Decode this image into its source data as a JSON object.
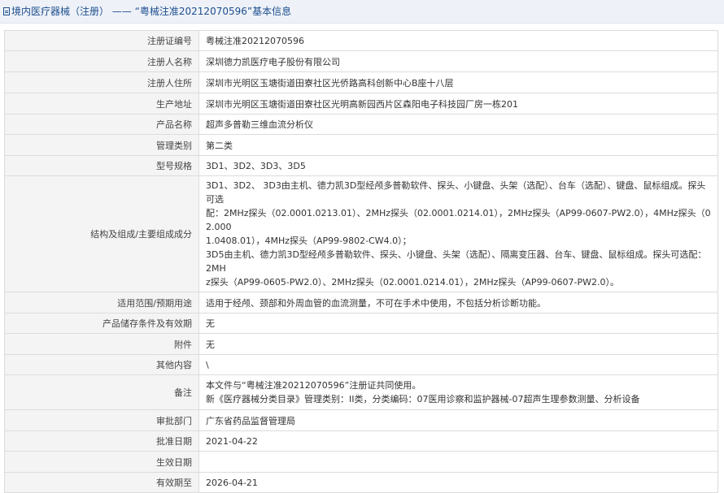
{
  "header": {
    "category": "境内医疗器械（注册）",
    "separator": "——",
    "title": "“粤械注准20212070596”基本信息"
  },
  "rows": [
    {
      "label": "注册证编号",
      "value": "粤械注准20212070596"
    },
    {
      "label": "注册人名称",
      "value": "深圳德力凯医疗电子股份有限公司"
    },
    {
      "label": "注册人住所",
      "value": "深圳市光明区玉塘街道田寮社区光侨路高科创新中心B座十八层"
    },
    {
      "label": "生产地址",
      "value": "深圳市光明区玉塘街道田寮社区光明高新园西片区森阳电子科技园厂房一栋201"
    },
    {
      "label": "产品名称",
      "value": "超声多普勒三维血流分析仪"
    },
    {
      "label": "管理类别",
      "value": "第二类"
    },
    {
      "label": "型号规格",
      "value": "3D1、3D2、3D3、3D5"
    },
    {
      "label": "结构及组成/主要组成成分",
      "lines": [
        "3D1、3D2、 3D3由主机、德力凯3D型经颅多普勒软件、探头、小键盘、头架（选配）、台车（选配）、键盘、鼠标组成。探头可选",
        "配：2MHz探头（02.0001.0213.01）、2MHz探头（02.0001.0214.01），2MHz探头（AP99-0607-PW2.0），4MHz探头（02.000",
        "1.0408.01），4MHz探头（AP99-9802-CW4.0）；",
        "3D5由主机、德力凯3D型经颅多普勒软件、探头、小键盘、头架（选配）、隔离变压器、台车、键盘、鼠标组成。探头可选配：2MH",
        "z探头（AP99-0605-PW2.0）、2MHz探头（02.0001.0214.01），2MHz探头（AP99-0607-PW2.0）。"
      ]
    },
    {
      "label": "适用范围/预期用途",
      "value": "适用于经颅、颈部和外周血管的血流测量，不可在手术中使用，不包括分析诊断功能。"
    },
    {
      "label": "产品储存条件及有效期",
      "value": "无"
    },
    {
      "label": "附件",
      "value": "无"
    },
    {
      "label": "其他内容",
      "value": "\\"
    },
    {
      "label": "备注",
      "lines": [
        "本文件与“粤械注准20212070596”注册证共同使用。",
        "新《医疗器械分类目录》管理类别：II类，分类编码：07医用诊察和监护器械-07超声生理参数测量、分析设备"
      ]
    },
    {
      "label": "审批部门",
      "value": "广东省药品监督管理局"
    },
    {
      "label": "批准日期",
      "value": "2021-04-22"
    },
    {
      "label": "生效日期",
      "value": ""
    },
    {
      "label": "有效期至",
      "value": "2026-04-21"
    }
  ]
}
